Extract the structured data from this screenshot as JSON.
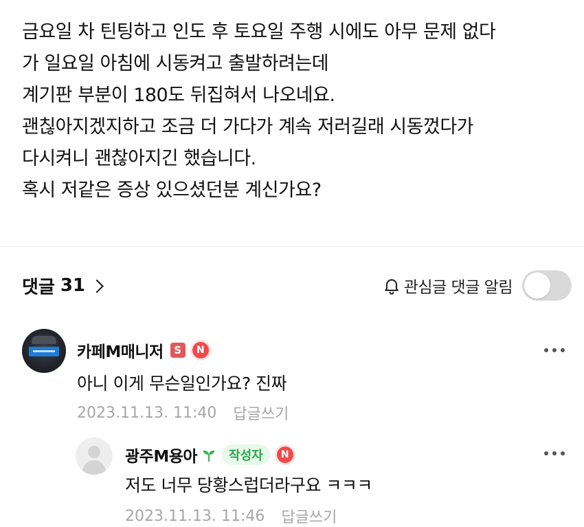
{
  "post": {
    "lines": [
      "금요일 차 틴팅하고 인도 후 토요일 주행 시에도 아무 문제 없다",
      "가 일요일 아침에 시동켜고 출발하려는데",
      "계기판 부분이 180도 뒤집혀서 나오네요.",
      "괜칞아지겠지하고 조금 더 가다가 계속 저러길래 시동껐다가",
      "다시켜니 괜찮아지긴 했습니다.",
      "혹시 저같은 증상 있으셨던분 계신가요?"
    ]
  },
  "comments_header": {
    "title": "댓글",
    "count": "31",
    "watch_label": "관심글 댓글 알림",
    "watch_enabled": false
  },
  "comments": [
    {
      "nickname": "카페M매니저",
      "badge_s": "S",
      "badge_n": "N",
      "text": "아니 이게 무슨일인가요? 진짜",
      "timestamp": "2023.11.13. 11:40",
      "reply_label": "답글쓰기"
    },
    {
      "nickname": "광주M용아",
      "author_badge": "작성자",
      "badge_n": "N",
      "text": "저도 너무 당황스럽더라구요 ㅋㅋㅋ",
      "timestamp": "2023.11.13. 11:46",
      "reply_label": "답글쓰기"
    }
  ],
  "colors": {
    "author_badge_bg": "#e8f8ea",
    "author_badge_text": "#2aa84a",
    "new_badge": "#f04a4a",
    "staff_badge": "#e05a5a",
    "meta_text": "#a6a6a6"
  }
}
